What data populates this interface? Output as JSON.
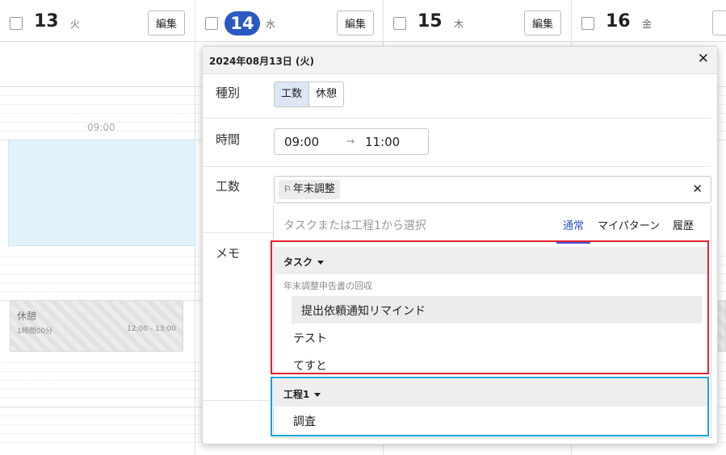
{
  "calendar": {
    "days": [
      {
        "num": "13",
        "weekday": "火",
        "edit": "編集"
      },
      {
        "num": "14",
        "weekday": "水",
        "edit": "編集"
      },
      {
        "num": "15",
        "weekday": "木",
        "edit": "編集"
      },
      {
        "num": "16",
        "weekday": "金",
        "edit": "編"
      }
    ],
    "time_label": "09:00",
    "break_event": {
      "title": "休憩",
      "duration": "1時間00分",
      "range": "12:00 - 13:00"
    }
  },
  "popup": {
    "date": "2024年08月13日 (火)",
    "close_icon": "close-icon",
    "type": {
      "label": "種別",
      "options": [
        "工数",
        "休憩"
      ],
      "selected": "工数"
    },
    "time": {
      "label": "時間",
      "start": "09:00",
      "arrow": "→",
      "end": "11:00"
    },
    "kosu": {
      "label": "工数",
      "chip": "年末調整",
      "chip_icon": "flag-icon"
    },
    "memo": {
      "label": "メモ"
    }
  },
  "dropdown": {
    "search_placeholder": "タスクまたは工程1から選択",
    "tabs": [
      "通常",
      "マイパターン",
      "履歴"
    ],
    "active_tab": "通常",
    "task_group": {
      "title": "タスク",
      "subheading": "年末調整申告書の回収",
      "items": [
        "提出依頼通知リマインド",
        "テスト",
        "てすと"
      ]
    },
    "process_group": {
      "title": "工程1",
      "items": [
        "調査"
      ]
    },
    "colors": {
      "task_outline": "#e2222d",
      "process_outline": "#1aa3dc",
      "active_tab": "#2b59c3"
    }
  }
}
